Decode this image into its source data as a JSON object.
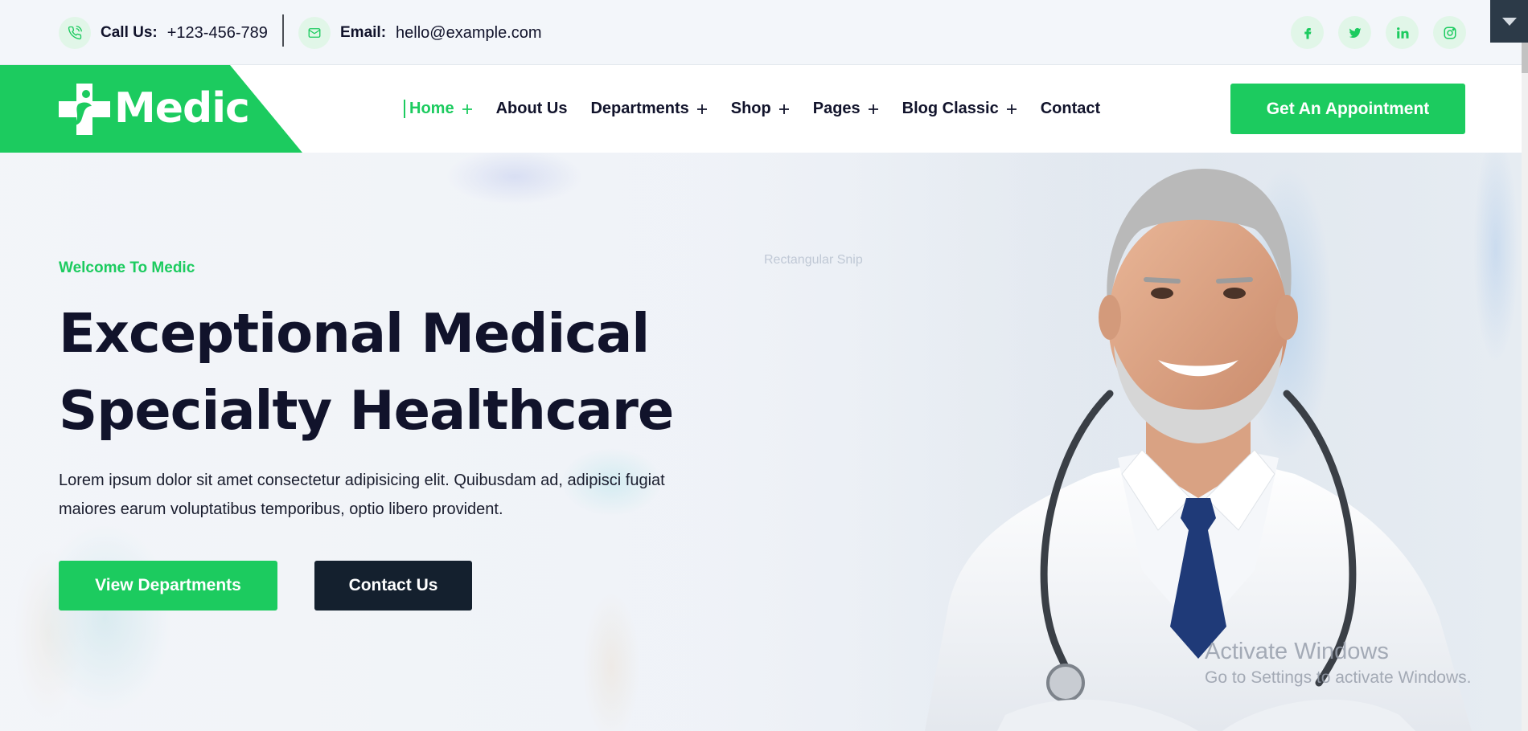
{
  "topbar": {
    "call_label": "Call Us:",
    "call_value": "+123-456-789",
    "email_label": "Email:",
    "email_value": "hello@example.com",
    "social": [
      {
        "icon": "facebook-icon"
      },
      {
        "icon": "twitter-icon"
      },
      {
        "icon": "linkedin-icon"
      },
      {
        "icon": "instagram-icon"
      }
    ]
  },
  "brand": {
    "name": "Medic",
    "accent_color": "#1ccb5f",
    "dark_color": "#14202e"
  },
  "nav": {
    "items": [
      {
        "label": "Home",
        "dropdown": true,
        "active": true
      },
      {
        "label": "About Us",
        "dropdown": false
      },
      {
        "label": "Departments",
        "dropdown": true
      },
      {
        "label": "Shop",
        "dropdown": true
      },
      {
        "label": "Pages",
        "dropdown": true
      },
      {
        "label": "Blog Classic",
        "dropdown": true
      },
      {
        "label": "Contact",
        "dropdown": false
      }
    ],
    "cta_label": "Get An Appointment"
  },
  "hero": {
    "faint_text": "Rectangular Snip",
    "subtitle": "Welcome To Medic",
    "title_line1": "Exceptional Medical",
    "title_line2": "Specialty Healthcare",
    "description": "Lorem ipsum dolor sit amet consectetur adipisicing elit. Quibusdam ad, adipisci fugiat maiores earum voluptatibus temporibus, optio libero provident.",
    "primary_button": "View Departments",
    "secondary_button": "Contact Us"
  },
  "watermark": {
    "title": "Activate Windows",
    "subtitle": "Go to Settings to activate Windows."
  }
}
